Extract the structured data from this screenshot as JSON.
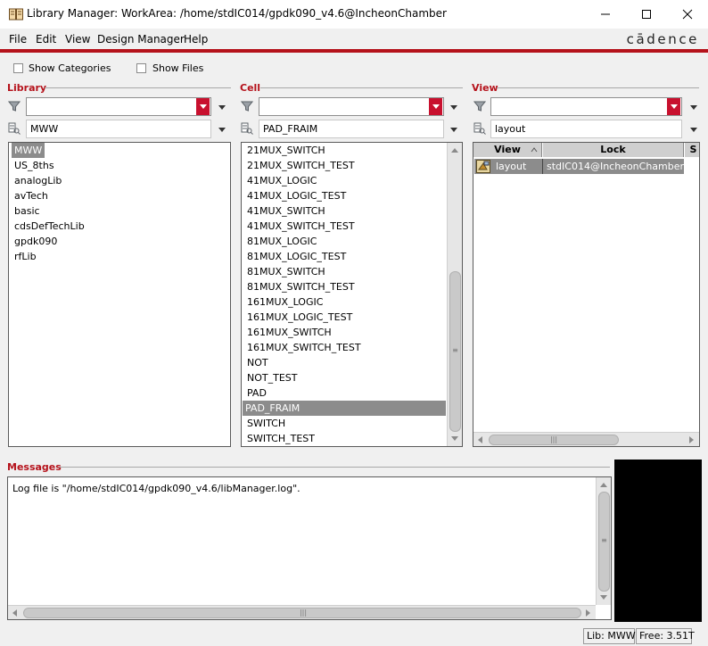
{
  "window": {
    "title": "Library Manager: WorkArea:  /home/stdIC014/gpdk090_v4.6@IncheonChamber",
    "controls": [
      "minimize-icon",
      "maximize-icon",
      "close-icon"
    ]
  },
  "menu": {
    "items": [
      {
        "label": "File"
      },
      {
        "label": "Edit"
      },
      {
        "label": "View"
      },
      {
        "label": "Design Manager"
      },
      {
        "label": "Help"
      }
    ],
    "logo": "cādence"
  },
  "options": {
    "show_categories": "Show Categories",
    "show_files": "Show Files"
  },
  "library": {
    "label": "Library",
    "filter_value": "",
    "search_value": "MWW",
    "items": [
      "MWW",
      "US_8ths",
      "analogLib",
      "avTech",
      "basic",
      "cdsDefTechLib",
      "gpdk090",
      "rfLib"
    ],
    "selected": "MWW"
  },
  "cell": {
    "label": "Cell",
    "filter_value": "",
    "search_value": "PAD_FRAIM",
    "items": [
      "21MUX_SWITCH",
      "21MUX_SWITCH_TEST",
      "41MUX_LOGIC",
      "41MUX_LOGIC_TEST",
      "41MUX_SWITCH",
      "41MUX_SWITCH_TEST",
      "81MUX_LOGIC",
      "81MUX_LOGIC_TEST",
      "81MUX_SWITCH",
      "81MUX_SWITCH_TEST",
      "161MUX_LOGIC",
      "161MUX_LOGIC_TEST",
      "161MUX_SWITCH",
      "161MUX_SWITCH_TEST",
      "NOT",
      "NOT_TEST",
      "PAD",
      "PAD_FRAIM",
      "SWITCH",
      "SWITCH_TEST"
    ],
    "selected": "PAD_FRAIM"
  },
  "view": {
    "label": "View",
    "filter_value": "",
    "search_value": "layout",
    "columns": [
      "View",
      "Lock",
      "S"
    ],
    "rows": [
      {
        "view": "layout",
        "lock": "stdIC014@IncheonChamber"
      }
    ]
  },
  "messages": {
    "label": "Messages",
    "text": "Log file is \"/home/stdIC014/gpdk090_v4.6/libManager.log\"."
  },
  "status": {
    "lib": "Lib: MWW",
    "free": "Free: 3.51T"
  },
  "colors": {
    "accent": "#b5121b",
    "selection": "#8c8c8c",
    "preview": "#000000"
  }
}
